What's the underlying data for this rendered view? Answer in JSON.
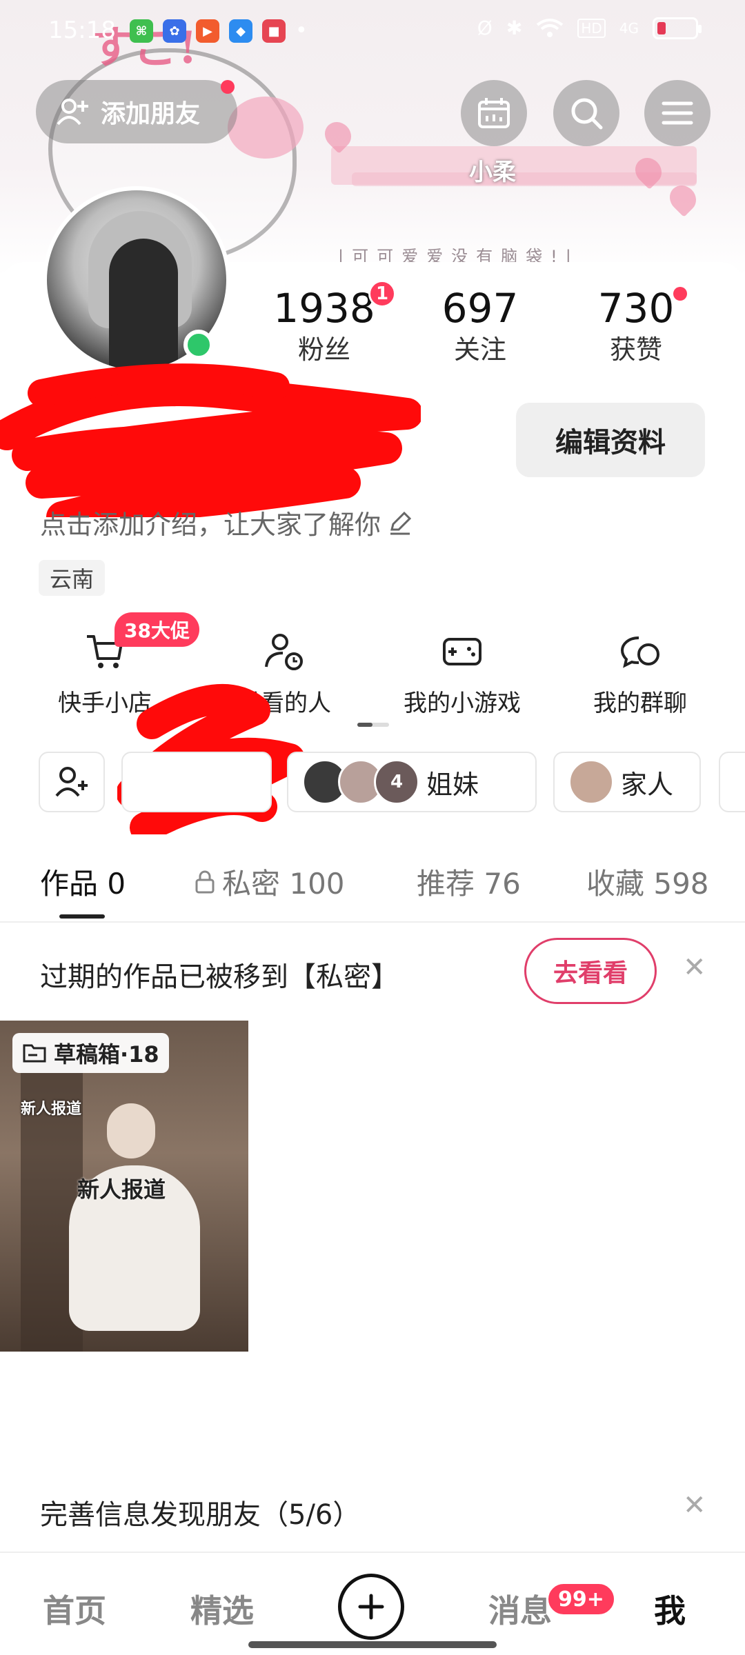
{
  "status_bar": {
    "time": "15:18",
    "dot": "•",
    "hd": "HD",
    "net": "4G"
  },
  "banner": {
    "name": "小柔",
    "slogan": "|可可爱爱没有脑袋!|"
  },
  "header": {
    "add_friend_label": "添加朋友"
  },
  "stats": [
    {
      "value": "1938",
      "label": "粉丝"
    },
    {
      "value": "697",
      "label": "关注"
    },
    {
      "value": "730",
      "label": "获赞"
    }
  ],
  "fans_badge": "1",
  "profile": {
    "edit_label": "编辑资料",
    "bio": "点击添加介绍，让大家了解你",
    "region": "云南"
  },
  "quick_entries": {
    "shop": "快手小店",
    "promo": "38大促",
    "frequent": "常看的人",
    "games": "我的小游戏",
    "groups": "我的群聊"
  },
  "chips": {
    "sisters": "姐妹",
    "sisters_count": "4",
    "family": "家人"
  },
  "tabs": {
    "works": "作品 0",
    "private": "私密 100",
    "recommend": "推荐 76",
    "favorites": "收藏 598"
  },
  "notice": {
    "text": "过期的作品已被移到【私密】",
    "button": "去看看"
  },
  "draft": {
    "label": "草稿箱·18",
    "caption_small": "新人报道",
    "caption_large": "新人报道"
  },
  "friend_prompt": "完善信息发现朋友（5/6）",
  "nav": {
    "home": "首页",
    "featured": "精选",
    "messages": "消息",
    "messages_badge": "99+",
    "me": "我"
  },
  "colors": {
    "accent": "#ff3b5c",
    "online": "#2ec76a",
    "button_pink": "#e03e6a"
  }
}
